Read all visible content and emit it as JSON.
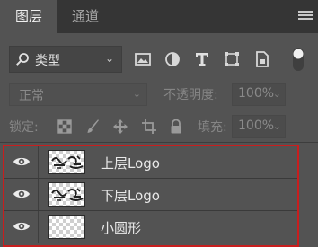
{
  "tabs": [
    {
      "label": "图层",
      "active": true
    },
    {
      "label": "通道",
      "active": false
    }
  ],
  "filter": {
    "kind_label": "类型",
    "icons": [
      "image-filter-icon",
      "adjustment-filter-icon",
      "type-filter-icon",
      "shape-filter-icon",
      "smart-object-filter-icon"
    ]
  },
  "blend": {
    "mode": "正常",
    "opacity_label": "不透明度:",
    "opacity_value": "100%"
  },
  "lock": {
    "label": "锁定:",
    "fill_label": "填充:",
    "fill_value": "100%"
  },
  "layers": [
    {
      "name": "上层Logo",
      "visible": true,
      "thumbnail": "logo"
    },
    {
      "name": "下层Logo",
      "visible": true,
      "thumbnail": "logo"
    },
    {
      "name": "小圆形",
      "visible": true,
      "thumbnail": "transparent"
    }
  ],
  "colors": {
    "panel_bg": "#535353",
    "tabbar_bg": "#353535",
    "highlight_border": "#c81e1e"
  }
}
